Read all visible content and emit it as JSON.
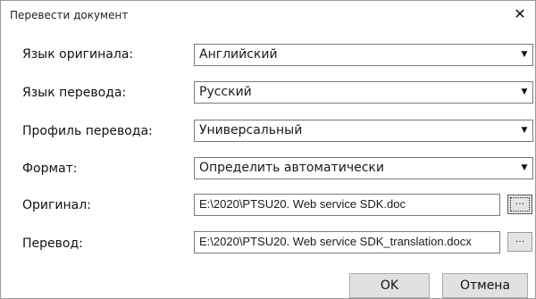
{
  "window": {
    "title": "Перевести документ",
    "close_glyph": "✕",
    "close_icon": "close-icon"
  },
  "form": {
    "source_language": {
      "label": "Язык оригинала:",
      "value": "Английский"
    },
    "target_language": {
      "label": "Язык перевода:",
      "value": "Русский"
    },
    "profile": {
      "label": "Профиль перевода:",
      "value": "Универсальный"
    },
    "format": {
      "label": "Формат:",
      "value": "Определить автоматически"
    },
    "original": {
      "label": "Оригинал:",
      "value": "E:\\2020\\PTSU20. Web service SDK.doc"
    },
    "translation": {
      "label": "Перевод:",
      "value": "E:\\2020\\PTSU20. Web service SDK_translation.docx"
    }
  },
  "icons": {
    "dropdown_arrow": "▼",
    "browse": "..."
  },
  "buttons": {
    "ok": "OK",
    "cancel": "Отмена"
  }
}
